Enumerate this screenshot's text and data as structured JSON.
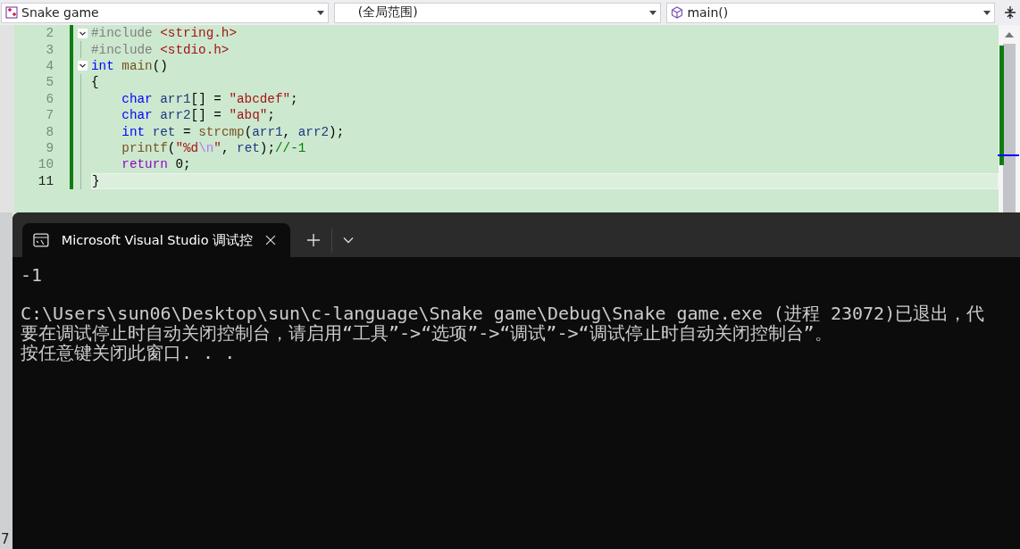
{
  "toolbar": {
    "project_dropdown": {
      "value": "Snake game"
    },
    "scope_dropdown": {
      "value": "(全局范围)"
    },
    "member_dropdown": {
      "value": "main()"
    }
  },
  "editor": {
    "lines": [
      {
        "number": "2",
        "foldable": true,
        "current": false,
        "tokens": [
          {
            "kind": "preproc",
            "text": "#include "
          },
          {
            "kind": "string",
            "text": "<string.h>"
          }
        ]
      },
      {
        "number": "3",
        "foldable": false,
        "current": false,
        "tokens": [
          {
            "kind": "preproc",
            "text": "#include "
          },
          {
            "kind": "string",
            "text": "<stdio.h>"
          }
        ]
      },
      {
        "number": "4",
        "foldable": true,
        "current": false,
        "tokens": [
          {
            "kind": "keyword",
            "text": "int "
          },
          {
            "kind": "func",
            "text": "main"
          },
          {
            "kind": "plain",
            "text": "()"
          }
        ]
      },
      {
        "number": "5",
        "foldable": false,
        "current": false,
        "tokens": [
          {
            "kind": "plain",
            "text": "{"
          }
        ]
      },
      {
        "number": "6",
        "foldable": false,
        "current": false,
        "tokens": [
          {
            "kind": "keyword",
            "text": "    char "
          },
          {
            "kind": "ident",
            "text": "arr1"
          },
          {
            "kind": "plain",
            "text": "[] = "
          },
          {
            "kind": "string",
            "text": "\"abcdef\""
          },
          {
            "kind": "plain",
            "text": ";"
          }
        ]
      },
      {
        "number": "7",
        "foldable": false,
        "current": false,
        "tokens": [
          {
            "kind": "keyword",
            "text": "    char "
          },
          {
            "kind": "ident",
            "text": "arr2"
          },
          {
            "kind": "plain",
            "text": "[] = "
          },
          {
            "kind": "string",
            "text": "\"abq\""
          },
          {
            "kind": "plain",
            "text": ";"
          }
        ]
      },
      {
        "number": "8",
        "foldable": false,
        "current": false,
        "tokens": [
          {
            "kind": "keyword",
            "text": "    int "
          },
          {
            "kind": "ident",
            "text": "ret"
          },
          {
            "kind": "plain",
            "text": " = "
          },
          {
            "kind": "func",
            "text": "strcmp"
          },
          {
            "kind": "plain",
            "text": "("
          },
          {
            "kind": "ident",
            "text": "arr1"
          },
          {
            "kind": "plain",
            "text": ", "
          },
          {
            "kind": "ident",
            "text": "arr2"
          },
          {
            "kind": "plain",
            "text": ");"
          }
        ]
      },
      {
        "number": "9",
        "foldable": false,
        "current": false,
        "tokens": [
          {
            "kind": "func",
            "text": "    printf"
          },
          {
            "kind": "plain",
            "text": "("
          },
          {
            "kind": "string",
            "text": "\"%d"
          },
          {
            "kind": "escape",
            "text": "\\n"
          },
          {
            "kind": "string",
            "text": "\""
          },
          {
            "kind": "plain",
            "text": ", "
          },
          {
            "kind": "ident",
            "text": "ret"
          },
          {
            "kind": "plain",
            "text": ");"
          },
          {
            "kind": "comment",
            "text": "//-1"
          }
        ]
      },
      {
        "number": "10",
        "foldable": false,
        "current": false,
        "tokens": [
          {
            "kind": "control",
            "text": "    return"
          },
          {
            "kind": "plain",
            "text": " 0;"
          }
        ]
      },
      {
        "number": "11",
        "foldable": false,
        "current": true,
        "tokens": [
          {
            "kind": "plain",
            "text": "}"
          }
        ]
      }
    ]
  },
  "side_status": "7",
  "terminal": {
    "tab": {
      "title": "Microsoft Visual Studio 调试控",
      "selected": true
    },
    "output": [
      {
        "lines": [
          "-1"
        ]
      },
      {
        "lines": [
          "C:\\Users\\sun06\\Desktop\\sun\\c-language\\Snake game\\Debug\\Snake game.exe (进程 23072)已退出，代",
          "要在调试停止时自动关闭控制台，请启用“工具”->“选项”->“调试”->“调试停止时自动关闭控制台”。",
          "按任意键关闭此窗口. . ."
        ]
      }
    ]
  }
}
